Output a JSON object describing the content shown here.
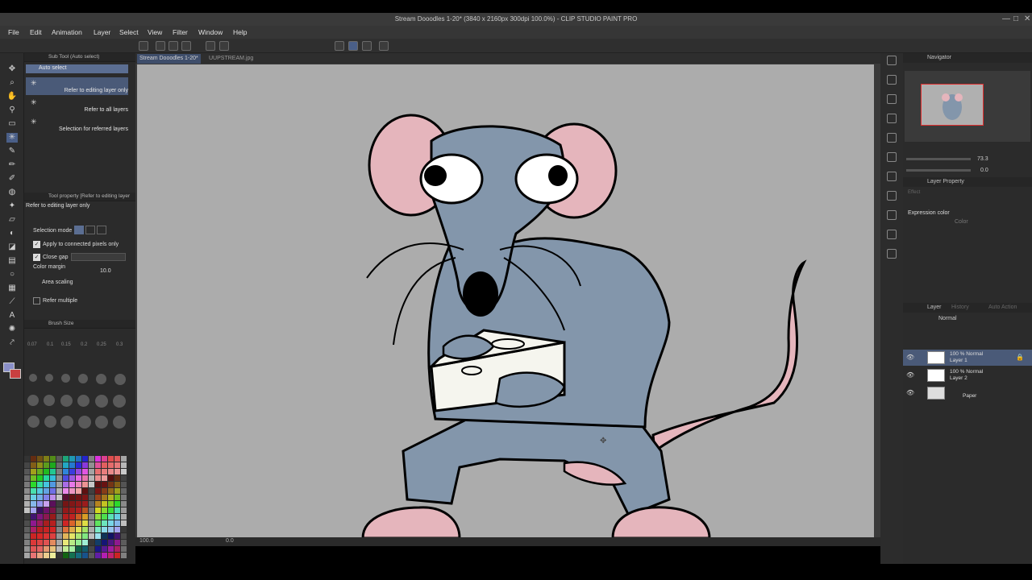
{
  "window": {
    "title": "Stream Dooodles 1-20* (3840 x 2160px 300dpi 100.0%) - CLIP STUDIO PAINT PRO"
  },
  "menu": [
    "File",
    "Edit",
    "Animation",
    "Layer",
    "Select",
    "View",
    "Filter",
    "Window",
    "Help"
  ],
  "subtool": {
    "header": "Sub Tool (Auto select)",
    "group": "Auto select",
    "items": [
      "Refer to editing layer only",
      "Refer to all layers",
      "Selection for referred layers"
    ]
  },
  "tool_property": {
    "header": "Tool property [Refer to editing layer",
    "current": "Refer to editing layer only",
    "selection_mode_label": "Selection mode",
    "apply_connected_label": "Apply to connected pixels only",
    "close_gap_label": "Close gap",
    "color_margin_label": "Color margin",
    "color_margin_value": "10.0",
    "area_scaling_label": "Area scaling",
    "refer_multiple_label": "Refer multiple"
  },
  "brush_size": {
    "header": "Brush Size",
    "sizes_row1": [
      "0.07",
      "0.1",
      "0.15",
      "0.2",
      "0.25",
      "0.3"
    ]
  },
  "tabs": [
    "Stream Dooodles 1-20*",
    "UUPSTREAM.jpg"
  ],
  "status": {
    "zoom": "100.0",
    "angle": "0.0"
  },
  "navigator": {
    "header": "Navigator",
    "zoom": "73.3",
    "rotation": "0.0"
  },
  "layer_property": {
    "header": "Layer Property",
    "effect_label": "Effect",
    "expression_color_label": "Expression color",
    "color_value": "Color"
  },
  "layers_panel": {
    "header": "Layer",
    "tab2": "History",
    "tab3": "Auto Action",
    "blend_mode": "Normal",
    "layers": [
      {
        "opacity_mode": "100 % Normal",
        "name": "Layer 1",
        "selected": true
      },
      {
        "opacity_mode": "100 % Normal",
        "name": "Layer 2",
        "selected": false
      },
      {
        "opacity_mode": "",
        "name": "Paper",
        "selected": false
      }
    ]
  },
  "colors": {
    "accent": "#5b6e92",
    "rat_body": "#8396ab",
    "rat_pink": "#e5b5bc",
    "canvas_bg": "#acacac"
  }
}
